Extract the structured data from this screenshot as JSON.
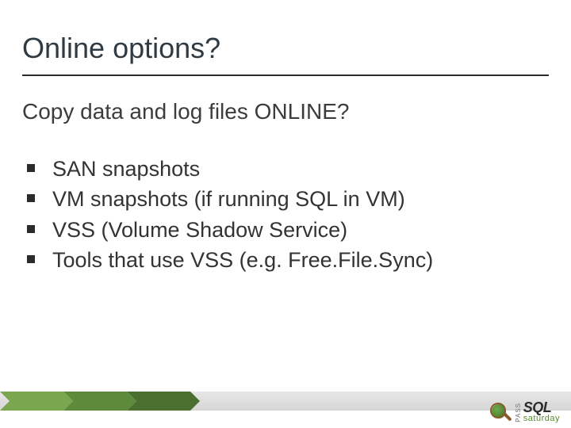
{
  "title": "Online options?",
  "subtitle": "Copy data and log files ONLINE?",
  "bullets": [
    "SAN snapshots",
    "VM snapshots (if running SQL in VM)",
    "VSS (Volume Shadow Service)",
    "Tools that use VSS (e.g. Free.File.Sync)"
  ],
  "footer": {
    "chevron_colors": [
      "#7aa64f",
      "#5e8a3c",
      "#4a6f2e"
    ],
    "logo": {
      "pass": "PASS",
      "sql": "SQL",
      "saturday": "saturday"
    }
  }
}
